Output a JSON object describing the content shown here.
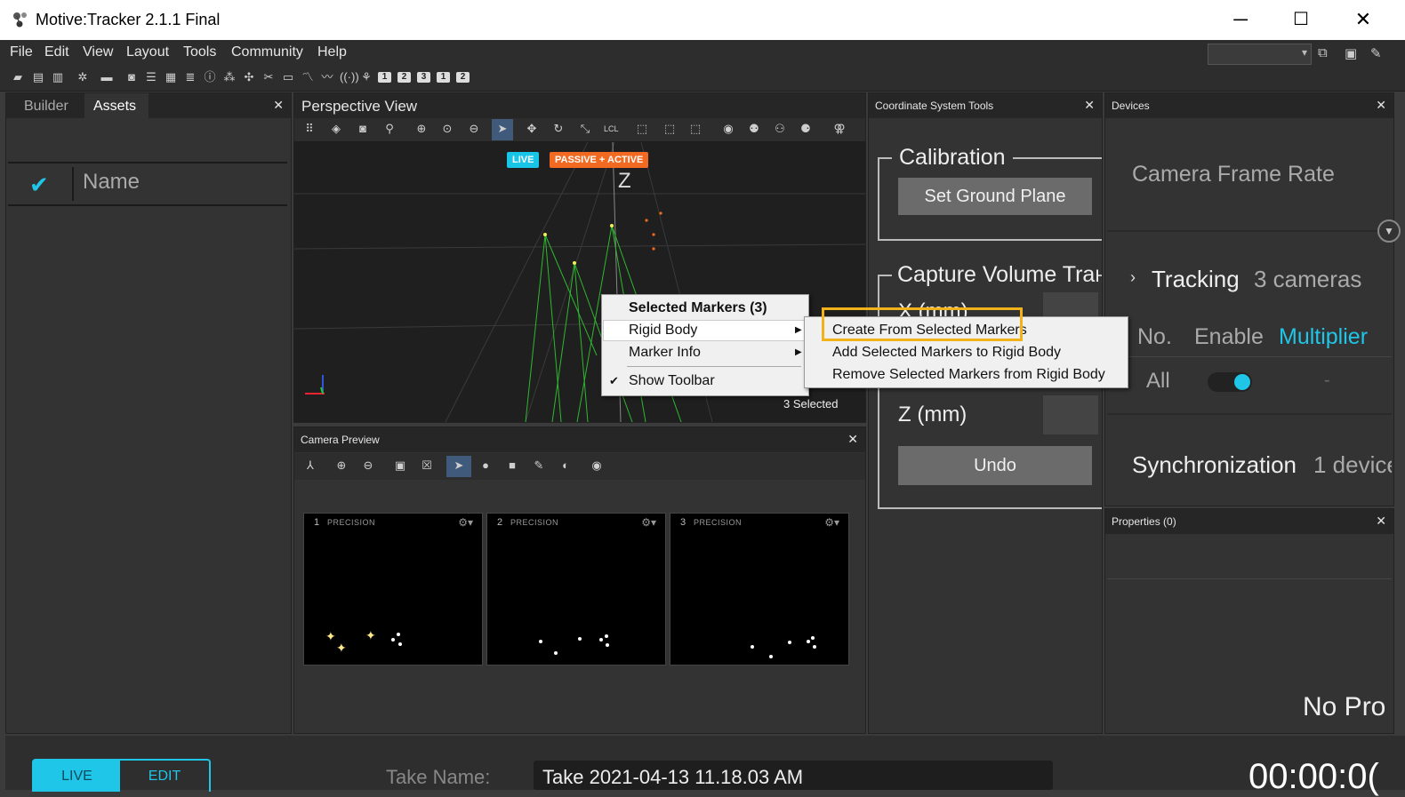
{
  "window": {
    "title": "Motive:Tracker 2.1.1 Final",
    "minimize": "─",
    "maximize": "☐",
    "close": "✕"
  },
  "menu": [
    "File",
    "Edit",
    "View",
    "Layout",
    "Tools",
    "Community",
    "Help"
  ],
  "toolbar_numbers": [
    "1",
    "2",
    "3",
    "1",
    "2"
  ],
  "assets": {
    "tabs": [
      "Builder",
      "Assets"
    ],
    "active_tab": "Assets",
    "column_name": "Name",
    "close": "✕"
  },
  "perspective": {
    "title": "Perspective View",
    "badge_live": "LIVE",
    "badge_mode": "PASSIVE + ACTIVE",
    "axis_label": "Z",
    "selected_count": "3 Selected"
  },
  "camera_preview": {
    "title": "Camera Preview",
    "close": "✕",
    "tiles": [
      {
        "num": "1",
        "label": "PRECISION"
      },
      {
        "num": "2",
        "label": "PRECISION"
      },
      {
        "num": "3",
        "label": "PRECISION"
      }
    ]
  },
  "coordinate_tools": {
    "title": "Coordinate System Tools",
    "close": "✕",
    "calibration_heading": "Calibration",
    "set_ground_plane": "Set Ground Plane",
    "capture_volume_heading": "Capture Volume Trar",
    "x_label": "X (mm)",
    "z_label": "Z (mm)",
    "undo": "Undo"
  },
  "devices": {
    "title": "Devices",
    "close": "✕",
    "camera_frame_rate": "Camera Frame Rate",
    "tracking_label": "Tracking",
    "tracking_count": "3 cameras",
    "col_no": "No.",
    "col_enable": "Enable",
    "col_multiplier": "Multiplier",
    "row_all": "All",
    "row_dash": "-",
    "synchronization": "Synchronization",
    "sync_count": "1 device"
  },
  "properties": {
    "title": "Properties (0)",
    "close": "✕",
    "no_pro": "No Pro"
  },
  "bottom": {
    "live": "LIVE",
    "edit": "EDIT",
    "take_label": "Take Name:",
    "take_value": "Take 2021-04-13 11.18.03 AM",
    "timecode": "00:00:0("
  },
  "context_menu": {
    "header": "Selected Markers (3)",
    "items": [
      "Rigid Body",
      "Marker Info",
      "Show Toolbar"
    ],
    "submenu": [
      "Create From Selected Markers",
      "Add Selected Markers to Rigid Body",
      "Remove Selected Markers from Rigid Body"
    ]
  },
  "colors": {
    "accent": "#1fc6e8",
    "highlight": "#f2b21a",
    "live_badge": "#19c5e6",
    "mode_badge": "#f26a21"
  }
}
